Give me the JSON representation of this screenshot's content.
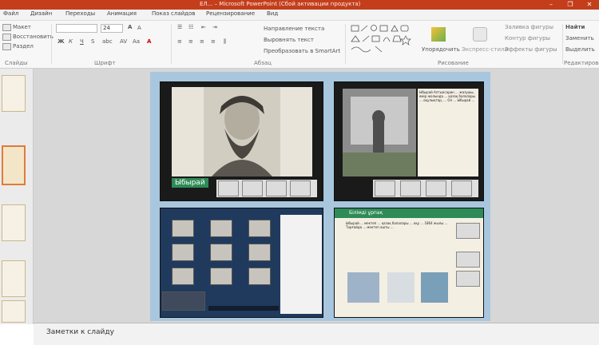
{
  "window": {
    "title": "ЕЛ... – Microsoft PowerPoint (Сбой активации продукта)"
  },
  "tabs": [
    "Файл",
    "Дизайн",
    "Переходы",
    "Анимация",
    "Показ слайдов",
    "Рецензирование",
    "Вид"
  ],
  "ribbon": {
    "slides": {
      "make": "Макет",
      "reset": "Восстановить",
      "section": "Раздел",
      "group": "Слайды"
    },
    "font": {
      "size": "24",
      "group": "Шрифт"
    },
    "paragraph": {
      "dir": "Направление текста",
      "align": "Выровнять текст",
      "smartart": "Преобразовать в SmartArt",
      "group": "Абзац"
    },
    "drawing": {
      "arrange": "Упорядочить",
      "styles": "Экспресс-стили",
      "fill": "Заливка фигуры",
      "outline": "Контур фигуры",
      "effects": "Эффекты фигуры",
      "group": "Рисование"
    },
    "editing": {
      "find": "Найти",
      "replace": "Заменить",
      "select": "Выделить",
      "group": "Редактирование"
    }
  },
  "slide": {
    "p1_caption": "Ыбырай",
    "p2_text": "Ыбырай Алтынсарин ... жазушы, өмір жолында ... қазақ балалары ... оқулықтар, ... Ол ... Ыбырай ...",
    "p4_header": "Білімді ұрпақ",
    "p4_text": "Ыбырай ... мектеп ... қазақ балалары ... оқу ... 1864 жылы ... Торғайда ... мектеп ашты ..."
  },
  "notes": {
    "label": "Заметки к слайду"
  },
  "colors": {
    "titlebar": "#c43e1c",
    "slide_bg": "#a8c7de",
    "caption": "#2e8b57"
  }
}
